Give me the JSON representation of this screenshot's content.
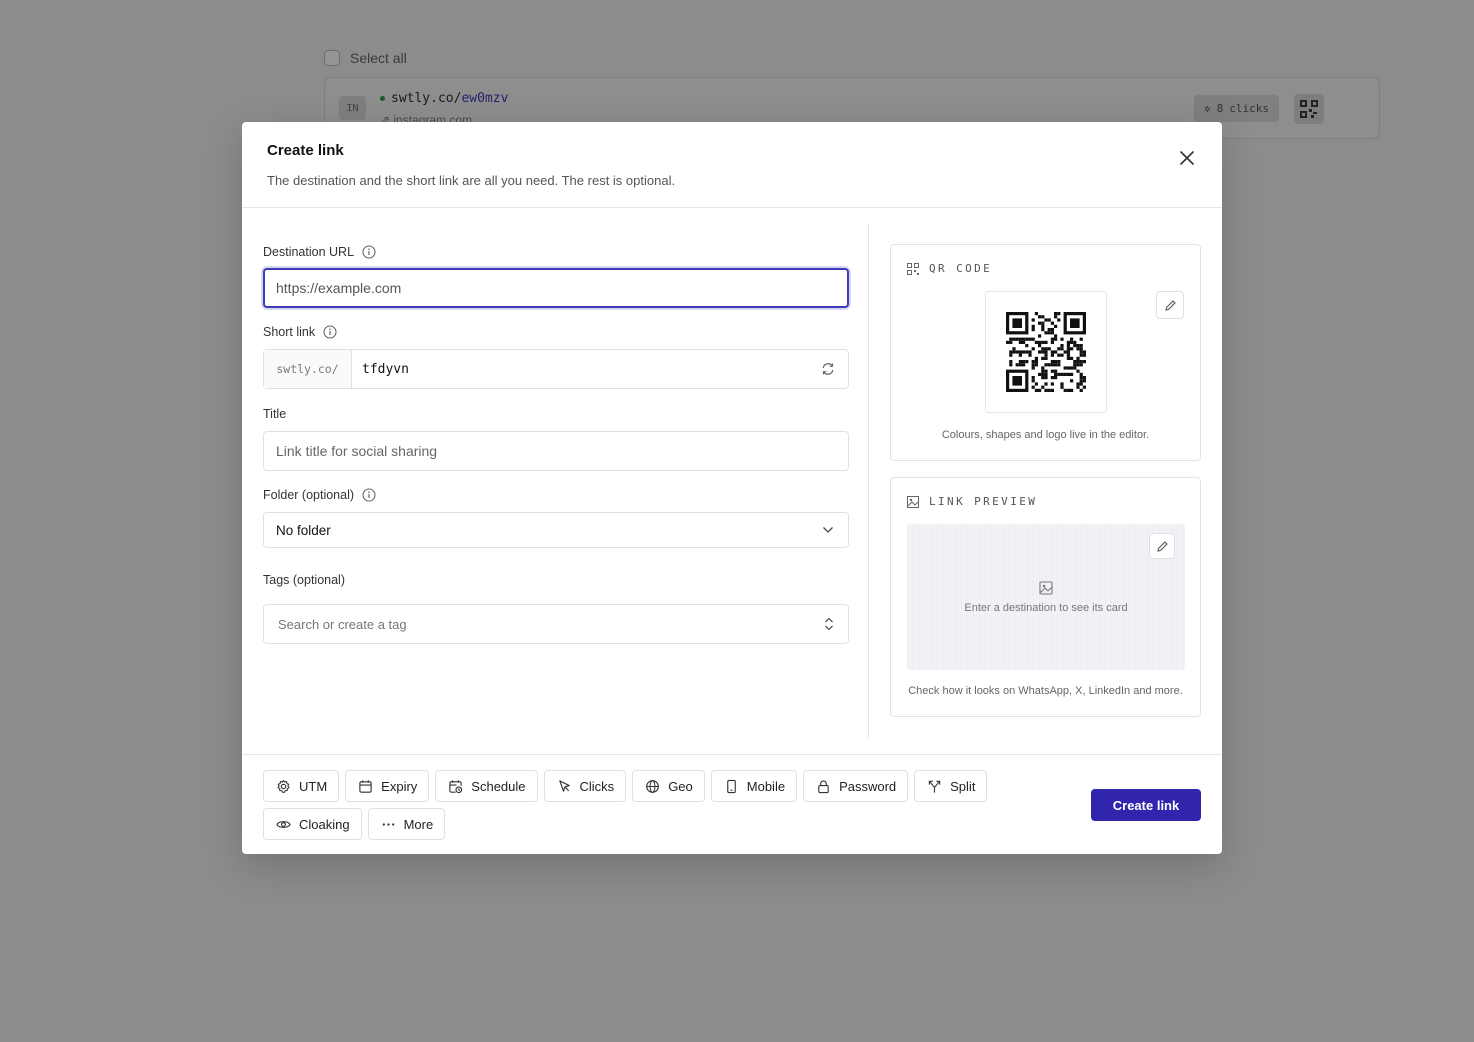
{
  "background": {
    "select_all_label": "Select all",
    "row": {
      "avatar": "IN",
      "domain": "swtly.co/",
      "slug": "ew0mzv",
      "destination": "instagram.com",
      "clicks_count": "8",
      "clicks_label": "clicks"
    }
  },
  "modal": {
    "title": "Create link",
    "description": "The destination and the short link are all you need. The rest is optional.",
    "fields": {
      "destination_label": "Destination URL",
      "destination_placeholder": "https://example.com",
      "short_label": "Short link",
      "short_prefix": "swtly.co/",
      "short_value": "tfdyvn",
      "title_label": "Title",
      "title_placeholder": "Link title for social sharing",
      "folder_label": "Folder (optional)",
      "folder_value": "No folder",
      "tags_label": "Tags (optional)",
      "tags_placeholder": "Search or create a tag"
    },
    "qr": {
      "heading": "QR CODE",
      "caption": "Colours, shapes and logo live in the editor."
    },
    "preview": {
      "heading": "LINK PREVIEW",
      "empty_text": "Enter a destination to see its card",
      "caption": "Check how it looks on WhatsApp, X, LinkedIn and more."
    },
    "options": [
      {
        "label": "UTM",
        "icon": "gear-icon"
      },
      {
        "label": "Expiry",
        "icon": "calendar-icon"
      },
      {
        "label": "Schedule",
        "icon": "calendar-clock-icon"
      },
      {
        "label": "Clicks",
        "icon": "cursor-icon"
      },
      {
        "label": "Geo",
        "icon": "globe-icon"
      },
      {
        "label": "Mobile",
        "icon": "phone-icon"
      },
      {
        "label": "Password",
        "icon": "lock-icon"
      },
      {
        "label": "Split",
        "icon": "split-icon"
      },
      {
        "label": "Cloaking",
        "icon": "eye-icon"
      },
      {
        "label": "More",
        "icon": "more-icon"
      }
    ],
    "submit_label": "Create link"
  },
  "colors": {
    "accent": "#3125ad",
    "focus_ring": "#3b3ab8",
    "overlay": "#8a8a8a"
  }
}
